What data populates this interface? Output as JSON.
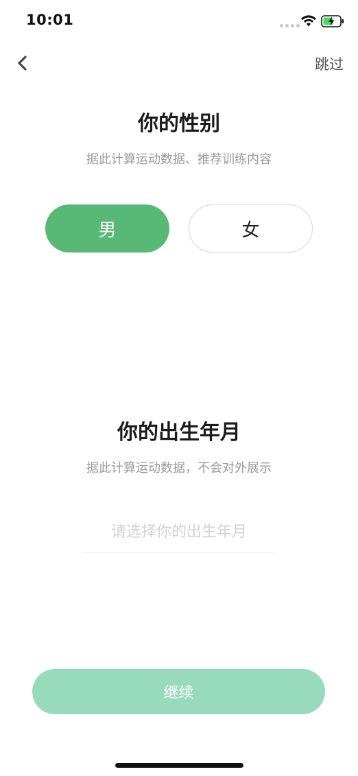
{
  "status_bar": {
    "time": "10:01",
    "icons": [
      "signal-dots-icon",
      "wifi-icon",
      "battery-charging-icon"
    ]
  },
  "nav": {
    "back_icon": "chevron-left-icon",
    "skip_label": "跳过"
  },
  "gender_section": {
    "title": "你的性别",
    "subtitle": "据此计算运动数据、推荐训练内容",
    "options": [
      {
        "label": "男",
        "selected": true
      },
      {
        "label": "女",
        "selected": false
      }
    ]
  },
  "birth_section": {
    "title": "你的出生年月",
    "subtitle": "据此计算运动数据，不会对外展示",
    "input_value": "",
    "input_placeholder": "请选择你的出生年月"
  },
  "continue_label": "继续",
  "colors": {
    "accent": "#57b975",
    "accent_light": "#98dbbc",
    "subtitle_gray": "#9a9a9a",
    "placeholder_gray": "#d2d2d2"
  }
}
